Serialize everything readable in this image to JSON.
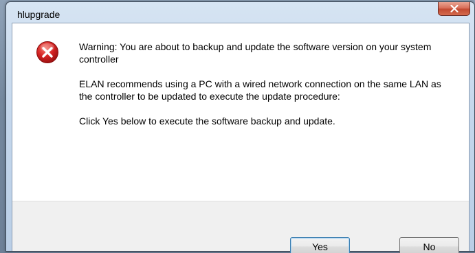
{
  "window": {
    "title": "hlupgrade"
  },
  "icons": {
    "close": "close-icon",
    "message": "error-icon"
  },
  "message": {
    "line1": "Warning: You are about to backup and update the software version on your system controller",
    "line2": "ELAN recommends using a PC with a wired network connection on the same LAN as the controller to be updated to execute the update procedure:",
    "line3": "Click Yes below to execute the software backup and update."
  },
  "buttons": {
    "yes_label": "Yes",
    "no_label": "No"
  },
  "colors": {
    "close_button": "#c24a32",
    "error_icon": "#d42222"
  }
}
